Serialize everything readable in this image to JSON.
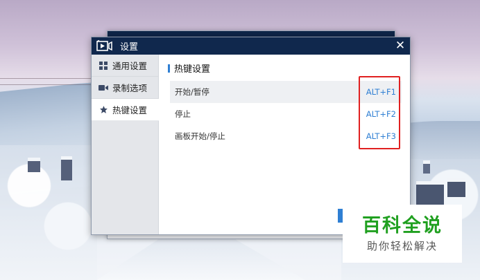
{
  "dialog": {
    "title": "设置",
    "close_label": "✕"
  },
  "sidebar": {
    "items": [
      {
        "label": "通用设置",
        "icon": "grid-icon",
        "active": false
      },
      {
        "label": "录制选项",
        "icon": "video-camera-icon",
        "active": false
      },
      {
        "label": "热键设置",
        "icon": "star-icon",
        "active": true
      }
    ]
  },
  "content": {
    "section_title": "热键设置",
    "hotkeys": [
      {
        "label": "开始/暂停",
        "value": "ALT+F1"
      },
      {
        "label": "停止",
        "value": "ALT+F2"
      },
      {
        "label": "画板开始/停止",
        "value": "ALT+F3"
      }
    ]
  },
  "watermark": {
    "main": "百科全说",
    "sub": "助你轻松解决"
  },
  "colors": {
    "titlebar": "#10284d",
    "accent": "#2f7fd3",
    "highlight_box": "#e02020",
    "watermark_green": "#20a020"
  }
}
